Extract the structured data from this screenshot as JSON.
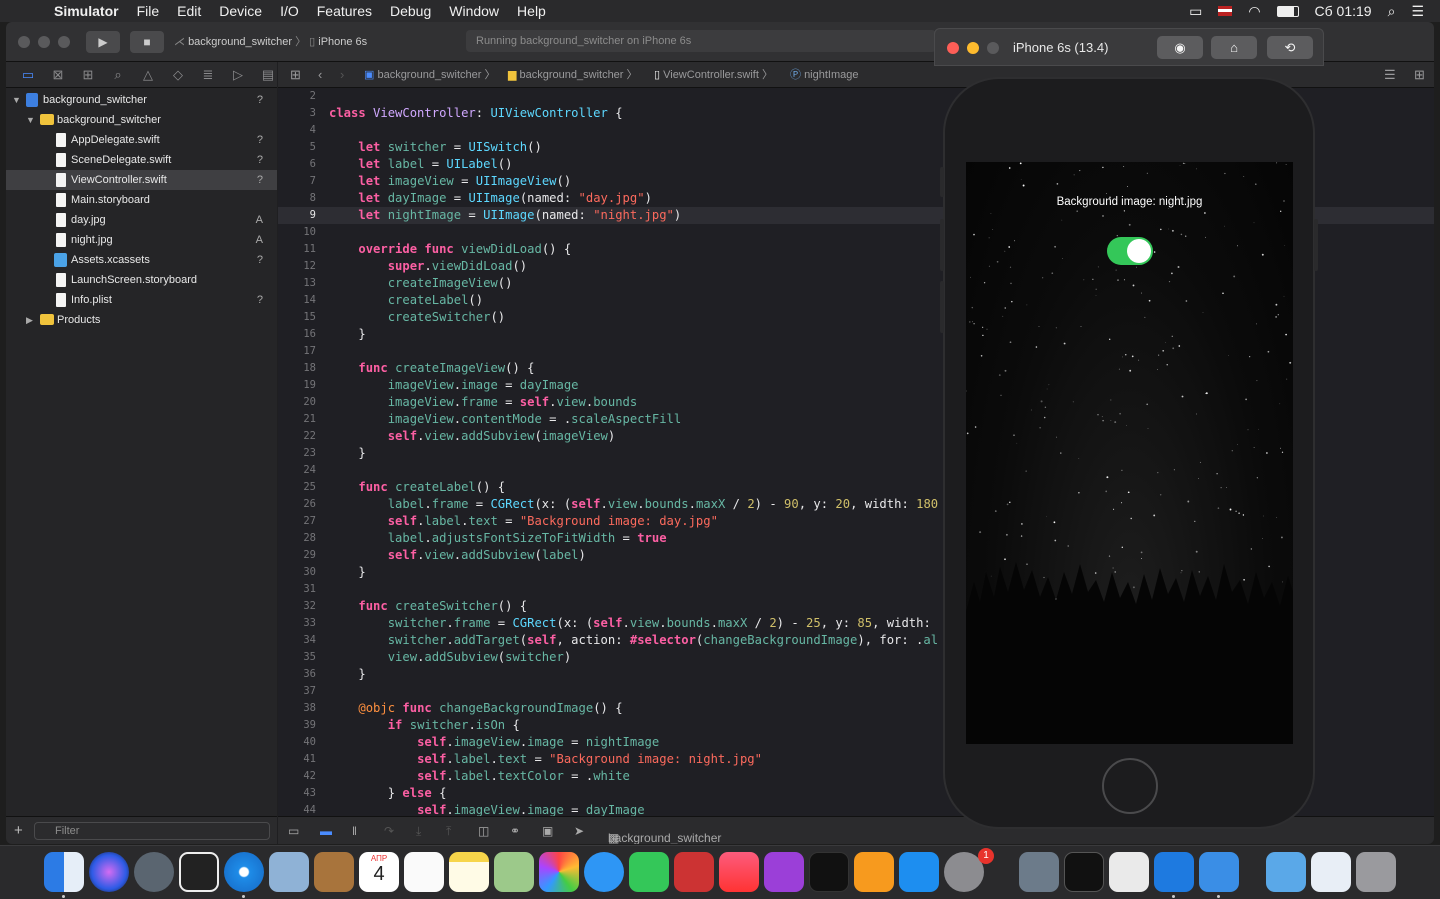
{
  "menubar": {
    "app": "Simulator",
    "items": [
      "File",
      "Edit",
      "Device",
      "I/O",
      "Features",
      "Debug",
      "Window",
      "Help"
    ],
    "clock": "Сб 01:19"
  },
  "toolbar": {
    "scheme": "background_switcher",
    "destination": "iPhone 6s",
    "activity": "Running background_switcher on iPhone 6s"
  },
  "navigator": {
    "items": [
      {
        "name": "background_switcher",
        "kind": "project",
        "status": "?"
      },
      {
        "name": "background_switcher",
        "kind": "folder",
        "status": ""
      },
      {
        "name": "AppDelegate.swift",
        "kind": "file",
        "status": "?"
      },
      {
        "name": "SceneDelegate.swift",
        "kind": "file",
        "status": "?"
      },
      {
        "name": "ViewController.swift",
        "kind": "file",
        "status": "?"
      },
      {
        "name": "Main.storyboard",
        "kind": "file",
        "status": ""
      },
      {
        "name": "day.jpg",
        "kind": "file",
        "status": "A"
      },
      {
        "name": "night.jpg",
        "kind": "file",
        "status": "A"
      },
      {
        "name": "Assets.xcassets",
        "kind": "asset",
        "status": "?"
      },
      {
        "name": "LaunchScreen.storyboard",
        "kind": "file",
        "status": ""
      },
      {
        "name": "Info.plist",
        "kind": "file",
        "status": "?"
      },
      {
        "name": "Products",
        "kind": "folder",
        "status": ""
      }
    ],
    "filter_placeholder": "Filter"
  },
  "jumpbar": {
    "crumbs": [
      "background_switcher",
      "background_switcher",
      "ViewController.swift",
      "nightImage"
    ]
  },
  "editor": {
    "current_line": 9,
    "lines": [
      {
        "n": 2,
        "html": ""
      },
      {
        "n": 3,
        "html": "<span class=\"kw\">class</span> <span class=\"ty\">ViewController</span>: <span class=\"tp\">UIViewController</span> {"
      },
      {
        "n": 4,
        "html": ""
      },
      {
        "n": 5,
        "html": "    <span class=\"kw\">let</span> <span class=\"pr\">switcher</span> = <span class=\"tp\">UISwitch</span>()"
      },
      {
        "n": 6,
        "html": "    <span class=\"kw\">let</span> <span class=\"pr\">label</span> = <span class=\"tp\">UILabel</span>()"
      },
      {
        "n": 7,
        "html": "    <span class=\"kw\">let</span> <span class=\"pr\">imageView</span> = <span class=\"tp\">UIImageView</span>()"
      },
      {
        "n": 8,
        "html": "    <span class=\"kw\">let</span> <span class=\"pr\">dayImage</span> = <span class=\"tp\">UIImage</span>(named: <span class=\"st\">\"day.jpg\"</span>)"
      },
      {
        "n": 9,
        "html": "    <span class=\"kw\">let</span> <span class=\"pr\">nightImage</span> = <span class=\"tp\">UIImage</span>(named: <span class=\"st\">\"night.jpg\"</span>)"
      },
      {
        "n": 10,
        "html": ""
      },
      {
        "n": 11,
        "html": "    <span class=\"kw\">override</span> <span class=\"kw\">func</span> <span class=\"fn\">viewDidLoad</span>() {"
      },
      {
        "n": 12,
        "html": "        <span class=\"kw\">super</span>.<span class=\"pr\">viewDidLoad</span>()"
      },
      {
        "n": 13,
        "html": "        <span class=\"pr\">createImageView</span>()"
      },
      {
        "n": 14,
        "html": "        <span class=\"pr\">createLabel</span>()"
      },
      {
        "n": 15,
        "html": "        <span class=\"pr\">createSwitcher</span>()"
      },
      {
        "n": 16,
        "html": "    }"
      },
      {
        "n": 17,
        "html": ""
      },
      {
        "n": 18,
        "html": "    <span class=\"kw\">func</span> <span class=\"fn\">createImageView</span>() {"
      },
      {
        "n": 19,
        "html": "        <span class=\"pr\">imageView</span>.<span class=\"pr\">image</span> = <span class=\"pr\">dayImage</span>"
      },
      {
        "n": 20,
        "html": "        <span class=\"pr\">imageView</span>.<span class=\"pr\">frame</span> = <span class=\"kw\">self</span>.<span class=\"pr\">view</span>.<span class=\"pr\">bounds</span>"
      },
      {
        "n": 21,
        "html": "        <span class=\"pr\">imageView</span>.<span class=\"pr\">contentMode</span> = .<span class=\"pr\">scaleAspectFill</span>"
      },
      {
        "n": 22,
        "html": "        <span class=\"kw\">self</span>.<span class=\"pr\">view</span>.<span class=\"pr\">addSubview</span>(<span class=\"pr\">imageView</span>)"
      },
      {
        "n": 23,
        "html": "    }"
      },
      {
        "n": 24,
        "html": ""
      },
      {
        "n": 25,
        "html": "    <span class=\"kw\">func</span> <span class=\"fn\">createLabel</span>() {"
      },
      {
        "n": 26,
        "html": "        <span class=\"pr\">label</span>.<span class=\"pr\">frame</span> = <span class=\"tp\">CGRect</span>(x: (<span class=\"kw\">self</span>.<span class=\"pr\">view</span>.<span class=\"pr\">bounds</span>.<span class=\"pr\">maxX</span> / <span class=\"nm\">2</span>) - <span class=\"nm\">90</span>, y: <span class=\"nm\">20</span>, width: <span class=\"nm\">180</span>"
      },
      {
        "n": 27,
        "html": "        <span class=\"kw\">self</span>.<span class=\"pr\">label</span>.<span class=\"pr\">text</span> = <span class=\"st\">\"Background image: day.jpg\"</span>"
      },
      {
        "n": 28,
        "html": "        <span class=\"pr\">label</span>.<span class=\"pr\">adjustsFontSizeToFitWidth</span> = <span class=\"kw\">true</span>"
      },
      {
        "n": 29,
        "html": "        <span class=\"kw\">self</span>.<span class=\"pr\">view</span>.<span class=\"pr\">addSubview</span>(<span class=\"pr\">label</span>)"
      },
      {
        "n": 30,
        "html": "    }"
      },
      {
        "n": 31,
        "html": ""
      },
      {
        "n": 32,
        "html": "    <span class=\"kw\">func</span> <span class=\"fn\">createSwitcher</span>() {"
      },
      {
        "n": 33,
        "html": "        <span class=\"pr\">switcher</span>.<span class=\"pr\">frame</span> = <span class=\"tp\">CGRect</span>(x: (<span class=\"kw\">self</span>.<span class=\"pr\">view</span>.<span class=\"pr\">bounds</span>.<span class=\"pr\">maxX</span> / <span class=\"nm\">2</span>) - <span class=\"nm\">25</span>, y: <span class=\"nm\">85</span>, width:"
      },
      {
        "n": 34,
        "html": "        <span class=\"pr\">switcher</span>.<span class=\"pr\">addTarget</span>(<span class=\"kw\">self</span>, action: <span class=\"kw\">#selector</span>(<span class=\"pr\">changeBackgroundImage</span>), for: .<span class=\"pr\">al</span>"
      },
      {
        "n": 35,
        "html": "        <span class=\"pr\">view</span>.<span class=\"pr\">addSubview</span>(<span class=\"pr\">switcher</span>)"
      },
      {
        "n": 36,
        "html": "    }"
      },
      {
        "n": 37,
        "html": ""
      },
      {
        "n": 38,
        "html": "    <span class=\"at\">@objc</span> <span class=\"kw\">func</span> <span class=\"fn\">changeBackgroundImage</span>() {"
      },
      {
        "n": 39,
        "html": "        <span class=\"kw\">if</span> <span class=\"pr\">switcher</span>.<span class=\"pr\">isOn</span> {"
      },
      {
        "n": 40,
        "html": "            <span class=\"kw\">self</span>.<span class=\"pr\">imageView</span>.<span class=\"pr\">image</span> = <span class=\"pr\">nightImage</span>"
      },
      {
        "n": 41,
        "html": "            <span class=\"kw\">self</span>.<span class=\"pr\">label</span>.<span class=\"pr\">text</span> = <span class=\"st\">\"Background image: night.jpg\"</span>"
      },
      {
        "n": 42,
        "html": "            <span class=\"kw\">self</span>.<span class=\"pr\">label</span>.<span class=\"pr\">textColor</span> = .<span class=\"pr\">white</span>"
      },
      {
        "n": 43,
        "html": "        } <span class=\"kw\">else</span> {"
      },
      {
        "n": 44,
        "html": "            <span class=\"kw\">self</span>.<span class=\"pr\">imageView</span>.<span class=\"pr\">image</span> = <span class=\"pr\">dayImage</span>"
      }
    ]
  },
  "debugbar": {
    "target": "background_switcher"
  },
  "simulator": {
    "title": "iPhone 6s (13.4)",
    "screen_label": "Background image: night.jpg",
    "switch_on": true
  },
  "dock": {
    "calendar_month": "АПР",
    "calendar_day": "4",
    "prefs_badge": "1"
  }
}
